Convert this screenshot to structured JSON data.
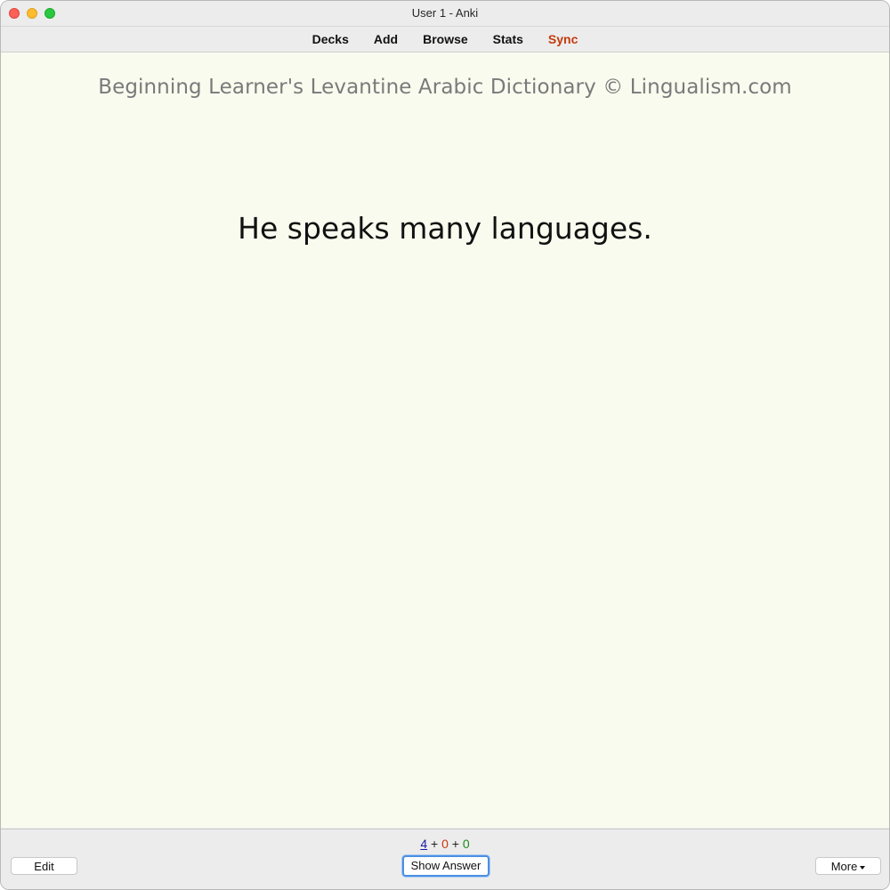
{
  "window": {
    "title": "User 1 - Anki"
  },
  "toolbar": {
    "items": [
      "Decks",
      "Add",
      "Browse",
      "Stats",
      "Sync"
    ]
  },
  "card": {
    "deck_header": "Beginning Learner's Levantine Arabic Dictionary © Lingualism.com",
    "question": "He speaks many languages."
  },
  "bottom": {
    "counts": {
      "new": "4",
      "learning": "0",
      "review": "0",
      "separator": "+"
    },
    "edit_label": "Edit",
    "show_answer_label": "Show Answer",
    "more_label": "More"
  },
  "colors": {
    "card_background": "#fafbef",
    "sync_accent": "#c43a0d",
    "new_count": "#1a1aa6",
    "learning_count": "#c43a0d",
    "review_count": "#1f8a1f",
    "focus_ring": "#4a90e2"
  }
}
